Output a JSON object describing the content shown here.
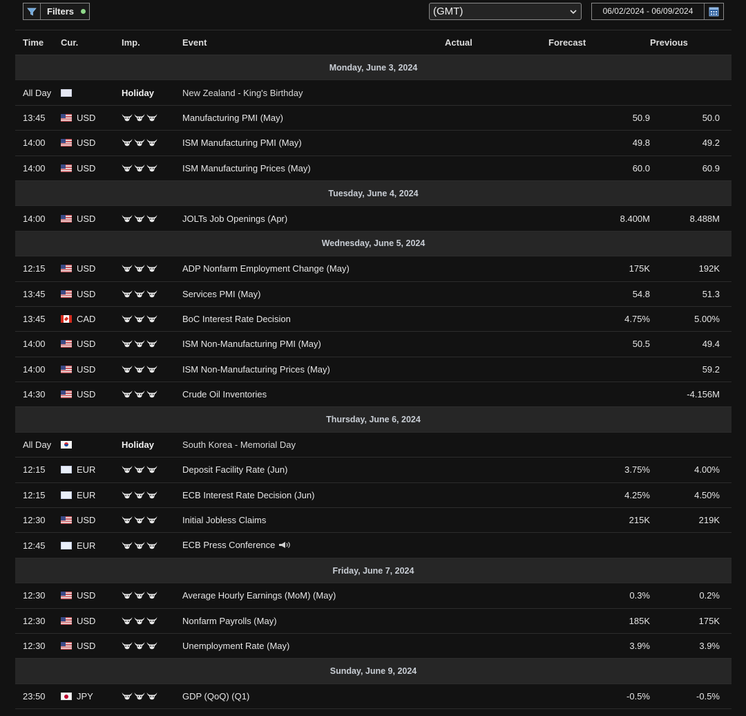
{
  "toolbar": {
    "filters_label": "Filters",
    "timezone": "(GMT)",
    "date_range": "06/02/2024 - 06/09/2024"
  },
  "columns": {
    "time": "Time",
    "currency": "Cur.",
    "importance": "Imp.",
    "event": "Event",
    "actual": "Actual",
    "forecast": "Forecast",
    "previous": "Previous"
  },
  "days": [
    {
      "label": "Monday, June 3, 2024",
      "events": [
        {
          "time": "All Day",
          "flag": "nz",
          "currency": "",
          "holiday": true,
          "importance_label": "Holiday",
          "event": "New Zealand - King's Birthday",
          "actual": "",
          "forecast": "",
          "previous": ""
        },
        {
          "time": "13:45",
          "flag": "us",
          "currency": "USD",
          "holiday": false,
          "bulls": 3,
          "event": "Manufacturing PMI (May)",
          "actual": "",
          "forecast": "50.9",
          "previous": "50.0"
        },
        {
          "time": "14:00",
          "flag": "us",
          "currency": "USD",
          "holiday": false,
          "bulls": 3,
          "event": "ISM Manufacturing PMI (May)",
          "actual": "",
          "forecast": "49.8",
          "previous": "49.2"
        },
        {
          "time": "14:00",
          "flag": "us",
          "currency": "USD",
          "holiday": false,
          "bulls": 3,
          "event": "ISM Manufacturing Prices (May)",
          "actual": "",
          "forecast": "60.0",
          "previous": "60.9"
        }
      ]
    },
    {
      "label": "Tuesday, June 4, 2024",
      "events": [
        {
          "time": "14:00",
          "flag": "us",
          "currency": "USD",
          "holiday": false,
          "bulls": 3,
          "event": "JOLTs Job Openings (Apr)",
          "actual": "",
          "forecast": "8.400M",
          "previous": "8.488M"
        }
      ]
    },
    {
      "label": "Wednesday, June 5, 2024",
      "events": [
        {
          "time": "12:15",
          "flag": "us",
          "currency": "USD",
          "holiday": false,
          "bulls": 3,
          "event": "ADP Nonfarm Employment Change (May)",
          "actual": "",
          "forecast": "175K",
          "previous": "192K"
        },
        {
          "time": "13:45",
          "flag": "us",
          "currency": "USD",
          "holiday": false,
          "bulls": 3,
          "event": "Services PMI (May)",
          "actual": "",
          "forecast": "54.8",
          "previous": "51.3"
        },
        {
          "time": "13:45",
          "flag": "ca",
          "currency": "CAD",
          "holiday": false,
          "bulls": 3,
          "event": "BoC Interest Rate Decision",
          "actual": "",
          "forecast": "4.75%",
          "previous": "5.00%"
        },
        {
          "time": "14:00",
          "flag": "us",
          "currency": "USD",
          "holiday": false,
          "bulls": 3,
          "event": "ISM Non-Manufacturing PMI (May)",
          "actual": "",
          "forecast": "50.5",
          "previous": "49.4"
        },
        {
          "time": "14:00",
          "flag": "us",
          "currency": "USD",
          "holiday": false,
          "bulls": 3,
          "event": "ISM Non-Manufacturing Prices (May)",
          "actual": "",
          "forecast": "",
          "previous": "59.2"
        },
        {
          "time": "14:30",
          "flag": "us",
          "currency": "USD",
          "holiday": false,
          "bulls": 3,
          "event": "Crude Oil Inventories",
          "actual": "",
          "forecast": "",
          "previous": "-4.156M"
        }
      ]
    },
    {
      "label": "Thursday, June 6, 2024",
      "events": [
        {
          "time": "All Day",
          "flag": "kr",
          "currency": "",
          "holiday": true,
          "importance_label": "Holiday",
          "event": "South Korea - Memorial Day",
          "actual": "",
          "forecast": "",
          "previous": ""
        },
        {
          "time": "12:15",
          "flag": "eu",
          "currency": "EUR",
          "holiday": false,
          "bulls": 3,
          "event": "Deposit Facility Rate (Jun)",
          "actual": "",
          "forecast": "3.75%",
          "previous": "4.00%"
        },
        {
          "time": "12:15",
          "flag": "eu",
          "currency": "EUR",
          "holiday": false,
          "bulls": 3,
          "event": "ECB Interest Rate Decision (Jun)",
          "actual": "",
          "forecast": "4.25%",
          "previous": "4.50%"
        },
        {
          "time": "12:30",
          "flag": "us",
          "currency": "USD",
          "holiday": false,
          "bulls": 3,
          "event": "Initial Jobless Claims",
          "actual": "",
          "forecast": "215K",
          "previous": "219K"
        },
        {
          "time": "12:45",
          "flag": "eu",
          "currency": "EUR",
          "holiday": false,
          "bulls": 3,
          "event": "ECB Press Conference",
          "speech": true,
          "actual": "",
          "forecast": "",
          "previous": ""
        }
      ]
    },
    {
      "label": "Friday, June 7, 2024",
      "events": [
        {
          "time": "12:30",
          "flag": "us",
          "currency": "USD",
          "holiday": false,
          "bulls": 3,
          "event": "Average Hourly Earnings (MoM) (May)",
          "actual": "",
          "forecast": "0.3%",
          "previous": "0.2%"
        },
        {
          "time": "12:30",
          "flag": "us",
          "currency": "USD",
          "holiday": false,
          "bulls": 3,
          "event": "Nonfarm Payrolls (May)",
          "actual": "",
          "forecast": "185K",
          "previous": "175K"
        },
        {
          "time": "12:30",
          "flag": "us",
          "currency": "USD",
          "holiday": false,
          "bulls": 3,
          "event": "Unemployment Rate (May)",
          "actual": "",
          "forecast": "3.9%",
          "previous": "3.9%"
        }
      ]
    },
    {
      "label": "Sunday, June 9, 2024",
      "events": [
        {
          "time": "23:50",
          "flag": "jp",
          "currency": "JPY",
          "holiday": false,
          "bulls": 3,
          "event": "GDP (QoQ) (Q1)",
          "actual": "",
          "forecast": "-0.5%",
          "previous": "-0.5%"
        }
      ]
    }
  ]
}
